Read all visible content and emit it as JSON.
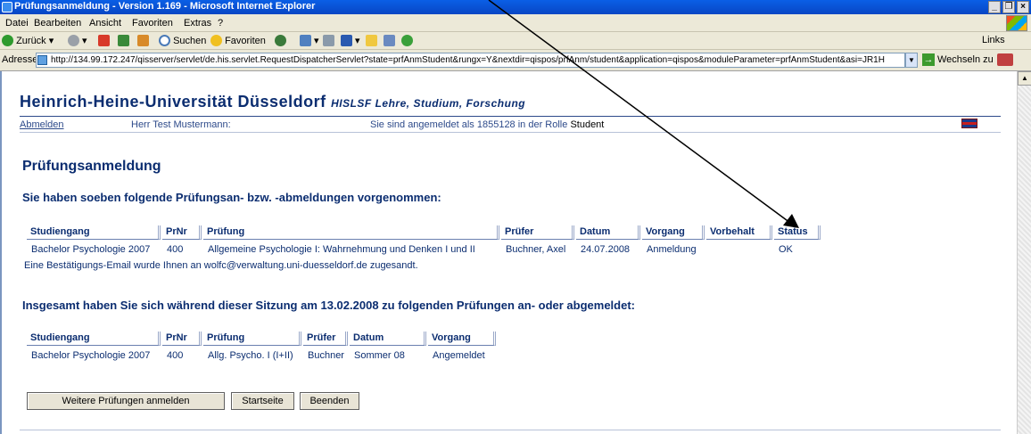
{
  "window": {
    "title": "Prüfungsanmeldung - Version 1.169 - Microsoft Internet Explorer",
    "min": "_",
    "max": "❐",
    "close": "×"
  },
  "menu": {
    "items": [
      "Datei",
      "Bearbeiten",
      "Ansicht",
      "Favoriten",
      "Extras",
      "?"
    ]
  },
  "toolbar": {
    "back": "Zurück",
    "search": "Suchen",
    "favorites": "Favoriten",
    "links": "Links"
  },
  "address": {
    "label": "Adresse",
    "url": "http://134.99.172.247/qisserver/servlet/de.his.servlet.RequestDispatcherServlet?state=prfAnmStudent&rungx=Y&nextdir=qispos/prfAnm/student&application=qispos&moduleParameter=prfAnmStudent&asi=JR1H",
    "go": "Wechseln zu"
  },
  "header": {
    "university": "Heinrich-Heine-Universität Düsseldorf",
    "tagline": "HISLSF Lehre, Studium, Forschung",
    "logout": "Abmelden",
    "user": "Herr Test Mustermann:",
    "login_info": "Sie sind angemeldet als 1855128 in der Rolle",
    "role": "Student"
  },
  "page": {
    "title": "Prüfungsanmeldung",
    "section1": "Sie haben soeben folgende Prüfungsan- bzw. -abmeldungen vorgenommen:",
    "section2": "Insgesamt haben Sie sich während dieser Sitzung am 13.02.2008 zu folgenden Prüfungen an- oder abgemeldet:",
    "confirmation": "Eine Bestätigungs-Email wurde Ihnen an wolfc@verwaltung.uni-duesseldorf.de zugesandt."
  },
  "table1": {
    "headers": [
      "Studiengang",
      "PrNr",
      "Prüfung",
      "Prüfer",
      "Datum",
      "Vorgang",
      "Vorbehalt",
      "Status"
    ],
    "row": [
      "Bachelor Psychologie 2007",
      "400",
      "Allgemeine Psychologie I: Wahrnehmung und Denken I und II",
      "Buchner, Axel",
      "24.07.2008",
      "Anmeldung",
      "",
      "OK"
    ]
  },
  "table2": {
    "headers": [
      "Studiengang",
      "PrNr",
      "Prüfung",
      "Prüfer",
      "Datum",
      "Vorgang"
    ],
    "row": [
      "Bachelor Psychologie 2007",
      "400",
      "Allg. Psycho. I (I+II)",
      "Buchner",
      "Sommer 08",
      "Angemeldet"
    ]
  },
  "buttons": {
    "more": "Weitere Prüfungen anmelden",
    "start": "Startseite",
    "end": "Beenden"
  }
}
